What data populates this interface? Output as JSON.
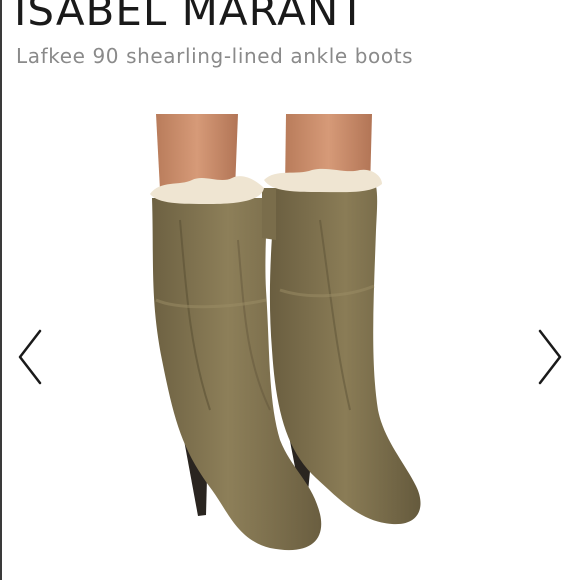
{
  "product": {
    "brand": "ISABEL MARANT",
    "title": "Lafkee 90 shearling-lined ankle boots"
  },
  "gallery": {
    "prev_icon": "chevron-left-icon",
    "next_icon": "chevron-right-icon",
    "image_subject": "olive leather boots with shearling lining"
  },
  "colors": {
    "boot_leather": "#857752",
    "shearling": "#efe5d2",
    "skin": "#c98a66",
    "heel": "#2a2520"
  }
}
